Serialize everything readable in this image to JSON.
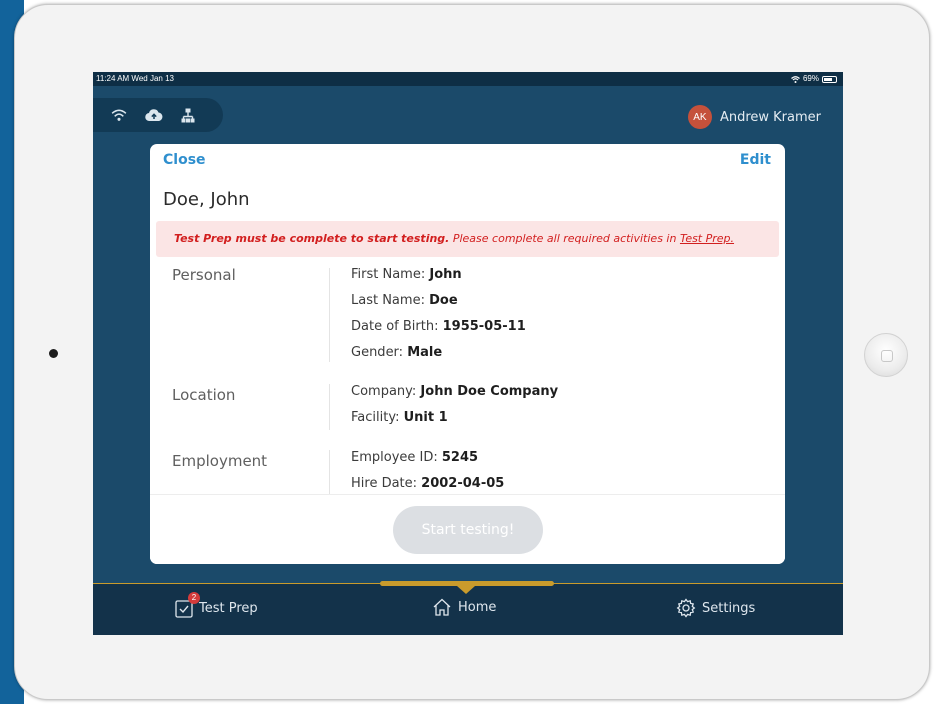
{
  "status_bar": {
    "time": "11:24 AM  Wed Jan 13",
    "battery": "69%"
  },
  "connection": {
    "wifi_icon": "wifi-icon",
    "cloud_icon": "cloud-upload-icon",
    "network_icon": "network-icon"
  },
  "user": {
    "initials": "AK",
    "name": "Andrew Kramer"
  },
  "modal": {
    "close_label": "Close",
    "edit_label": "Edit",
    "title": "Doe, John",
    "alert": {
      "strong": "Test Prep must be complete to start testing.",
      "text": "Please complete all required activities in",
      "link": "Test Prep."
    },
    "sections": [
      {
        "label": "Personal",
        "fields": [
          {
            "label": "First Name:",
            "value": "John"
          },
          {
            "label": "Last Name:",
            "value": "Doe"
          },
          {
            "label": "Date of Birth:",
            "value": "1955-05-11"
          },
          {
            "label": "Gender:",
            "value": "Male"
          }
        ]
      },
      {
        "label": "Location",
        "fields": [
          {
            "label": "Company:",
            "value": "John Doe Company"
          },
          {
            "label": "Facility:",
            "value": "Unit 1"
          }
        ]
      },
      {
        "label": "Employment",
        "fields": [
          {
            "label": "Employee ID:",
            "value": "5245"
          },
          {
            "label": "Hire Date:",
            "value": "2002-04-05"
          }
        ]
      }
    ],
    "start_button": "Start testing!"
  },
  "tabs": [
    {
      "label": "Test Prep",
      "icon": "clipboard-check-icon",
      "badge": "2"
    },
    {
      "label": "Home",
      "icon": "home-icon",
      "active": true
    },
    {
      "label": "Settings",
      "icon": "gear-icon"
    }
  ],
  "colors": {
    "accent": "#2f8fce",
    "screen_bg": "#1b4a6a",
    "tab_bar": "#13324a",
    "highlight": "#c99b2c",
    "alert_text": "#d21f1f",
    "alert_bg": "#fbe5e5"
  }
}
